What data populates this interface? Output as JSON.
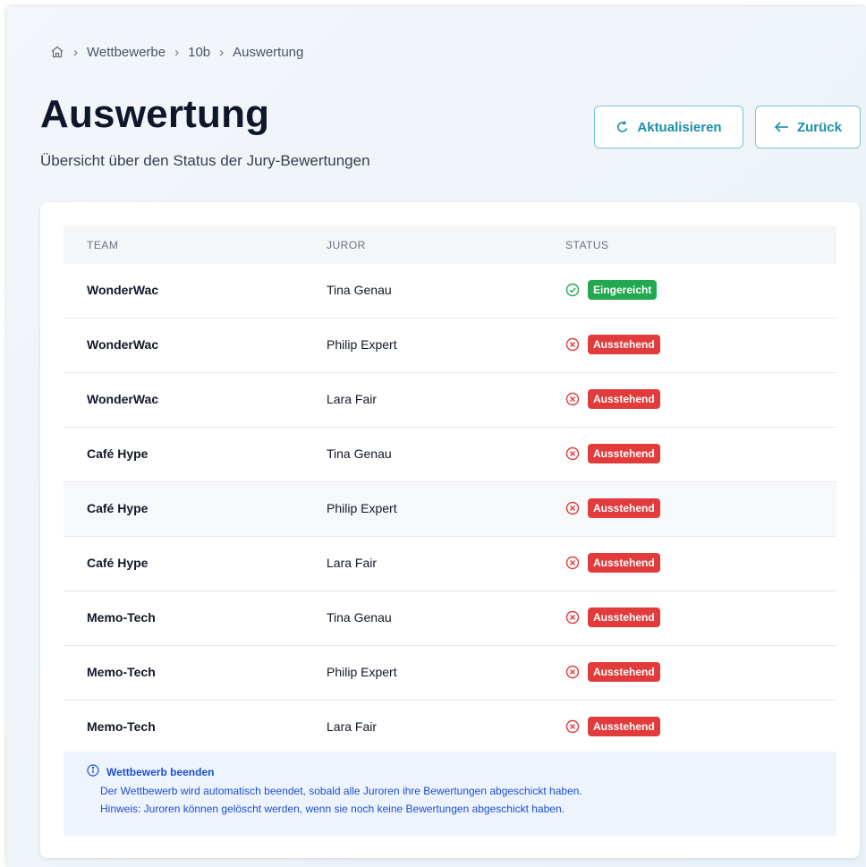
{
  "breadcrumb": {
    "items": [
      "Wettbewerbe",
      "10b",
      "Auswertung"
    ]
  },
  "header": {
    "title": "Auswertung",
    "subtitle": "Übersicht über den Status der Jury-Bewertungen",
    "refresh_label": "Aktualisieren",
    "back_label": "Zurück"
  },
  "table": {
    "columns": [
      "TEAM",
      "JUROR",
      "STATUS"
    ],
    "rows": [
      {
        "team": "WonderWac",
        "juror": "Tina Genau",
        "status": "Eingereicht"
      },
      {
        "team": "WonderWac",
        "juror": "Philip Expert",
        "status": "Ausstehend"
      },
      {
        "team": "WonderWac",
        "juror": "Lara Fair",
        "status": "Ausstehend"
      },
      {
        "team": "Café Hype",
        "juror": "Tina Genau",
        "status": "Ausstehend"
      },
      {
        "team": "Café Hype",
        "juror": "Philip Expert",
        "status": "Ausstehend"
      },
      {
        "team": "Café Hype",
        "juror": "Lara Fair",
        "status": "Ausstehend"
      },
      {
        "team": "Memo-Tech",
        "juror": "Tina Genau",
        "status": "Ausstehend"
      },
      {
        "team": "Memo-Tech",
        "juror": "Philip Expert",
        "status": "Ausstehend"
      },
      {
        "team": "Memo-Tech",
        "juror": "Lara Fair",
        "status": "Ausstehend"
      }
    ]
  },
  "notice": {
    "title": "Wettbewerb beenden",
    "line1": "Der Wettbewerb wird automatisch beendet, sobald alle Juroren ihre Bewertungen abgeschickt haben.",
    "line2": "Hinweis: Juroren können gelöscht werden, wenn sie noch keine Bewertungen abgeschickt haben."
  },
  "colors": {
    "accent": "#1a8fa8",
    "submitted": "#22a94f",
    "pending": "#e23b3b",
    "notice_text": "#1d4ed8"
  },
  "icons": {
    "home": "home-icon",
    "refresh": "refresh-icon",
    "back": "arrow-left-icon",
    "submitted": "check-circle-icon",
    "pending": "x-circle-icon",
    "info": "info-icon"
  }
}
